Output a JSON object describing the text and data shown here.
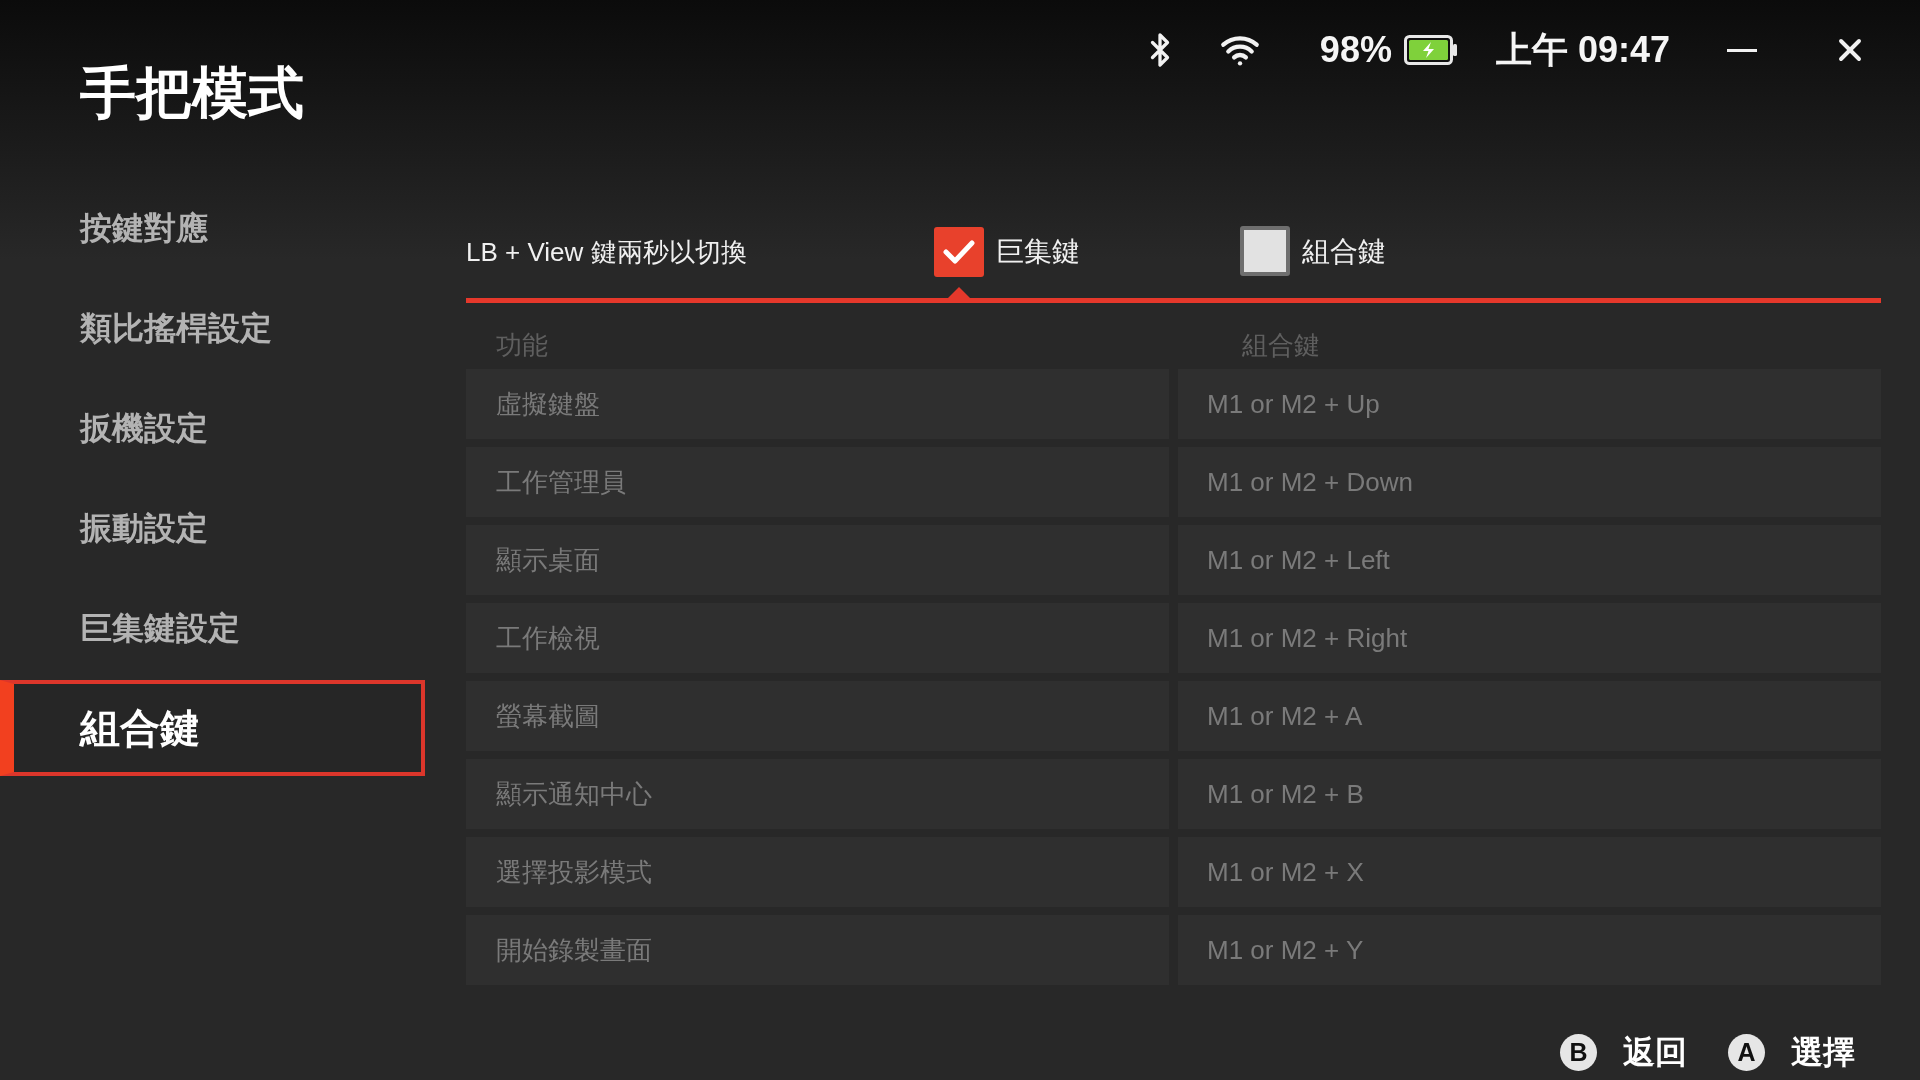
{
  "status_bar": {
    "battery_text": "98%",
    "charging": true,
    "time": "上午 09:47"
  },
  "title": "手把模式",
  "sidebar": {
    "items": [
      {
        "label": "按鍵對應",
        "selected": false
      },
      {
        "label": "類比搖桿設定",
        "selected": false
      },
      {
        "label": "扳機設定",
        "selected": false
      },
      {
        "label": "振動設定",
        "selected": false
      },
      {
        "label": "巨集鍵設定",
        "selected": false
      },
      {
        "label": "組合鍵",
        "selected": true
      }
    ]
  },
  "mode_switch": {
    "hint": "LB + View 鍵兩秒以切換",
    "options": [
      {
        "label": "巨集鍵",
        "checked": true
      },
      {
        "label": "組合鍵",
        "checked": false
      }
    ]
  },
  "table": {
    "columns": [
      "功能",
      "組合鍵"
    ],
    "rows": [
      [
        "虛擬鍵盤",
        "M1 or M2 + Up"
      ],
      [
        "工作管理員",
        "M1 or M2 + Down"
      ],
      [
        "顯示桌面",
        "M1 or M2 + Left"
      ],
      [
        "工作檢視",
        "M1 or M2 + Right"
      ],
      [
        "螢幕截圖",
        "M1 or M2 + A"
      ],
      [
        "顯示通知中心",
        "M1 or M2 + B"
      ],
      [
        "選擇投影模式",
        "M1 or M2 + X"
      ],
      [
        "開始錄製畫面",
        "M1 or M2 + Y"
      ]
    ]
  },
  "footer": {
    "actions": [
      {
        "key": "B",
        "label": "返回"
      },
      {
        "key": "A",
        "label": "選擇"
      }
    ]
  }
}
